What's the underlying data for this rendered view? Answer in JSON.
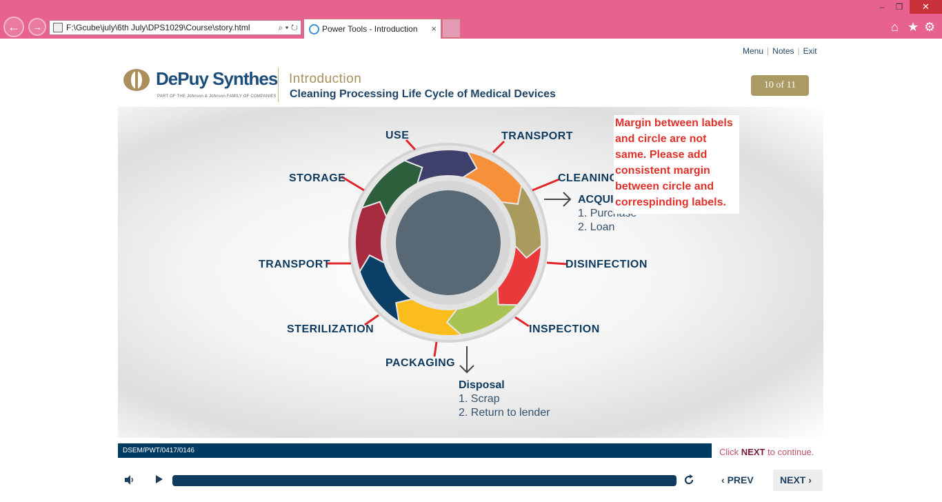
{
  "browser": {
    "address": "F:\\Gcube\\july\\6th July\\DPS1029\\Course\\story.html",
    "tab_title": "Power Tools - Introduction",
    "tab_close": "×",
    "address_controls": "⌕ ▾ ↻"
  },
  "top_links": {
    "menu": "Menu",
    "notes": "Notes",
    "exit": "Exit"
  },
  "header": {
    "brand": "DePuy Synthes",
    "brand_tagline": "PART OF THE Johnson & Johnson FAMILY OF COMPANIES",
    "section_title": "Introduction",
    "section_subtitle": "Cleaning Processing Life Cycle of Medical Devices",
    "page_counter": "10 of 11"
  },
  "cycle": {
    "colors": [
      "#f6913a",
      "#a99a5e",
      "#e9393a",
      "#a8c354",
      "#fbbd1b",
      "#0c3f66",
      "#a72b3e",
      "#2d5f3d",
      "#3f3f6b"
    ],
    "labels": {
      "use": "USE",
      "transport_top": "TRANSPORT",
      "cleaning": "CLEANING",
      "disinfection": "DISINFECTION",
      "inspection": "INSPECTION",
      "packaging": "PACKAGING",
      "sterilization": "STERILIZATION",
      "transport_left": "TRANSPORT",
      "storage": "STORAGE"
    },
    "acquisition": {
      "heading": "ACQUI",
      "items": [
        "1.   Purchase",
        "2.   Loan"
      ]
    },
    "disposal": {
      "heading": "Disposal",
      "items": [
        "1.   Scrap",
        "2.   Return to lender"
      ]
    }
  },
  "review_note": "Margin between labels and circle are not same. Please add consistent margin between circle and correspinding labels.",
  "footer": {
    "code": "DSEM/PWT/0417/0146",
    "continue_pre": "Click ",
    "continue_next": "NEXT",
    "continue_post": " to continue.",
    "prev_label": "PREV",
    "next_label": "NEXT"
  }
}
